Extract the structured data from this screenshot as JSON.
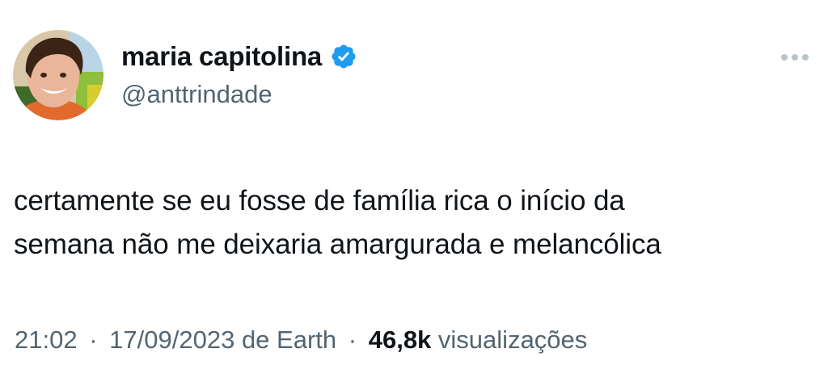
{
  "user": {
    "display_name": "maria capitolina",
    "handle": "@anttrindade",
    "verified_icon": "verified-badge-icon",
    "verified_color": "#1d9bf0"
  },
  "tweet": {
    "text_lines": [
      "certamente se eu fosse de família rica o início da",
      "semana não me deixaria amargurada e melancólica"
    ]
  },
  "meta": {
    "time": "21:02",
    "date": "17/09/2023",
    "source": "de Earth",
    "views_count": "46,8k",
    "views_label": "visualizações",
    "separator": "·"
  },
  "colors": {
    "text_primary": "#0f1419",
    "text_secondary": "#536471",
    "more_icon": "#b9c3cc"
  },
  "icons": {
    "more": "more-options-icon"
  }
}
